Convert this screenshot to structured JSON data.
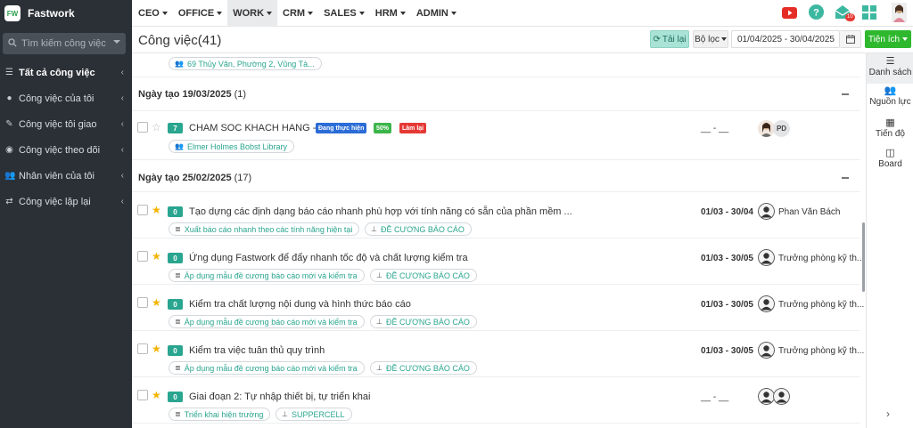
{
  "app": {
    "name": "Fastwork",
    "logo_text": "FW"
  },
  "sidebar": {
    "search_placeholder": "Tìm kiếm công việc",
    "items": [
      {
        "label": "Tất cả công việc",
        "icon": "list-icon"
      },
      {
        "label": "Công việc của tôi",
        "icon": "user-icon"
      },
      {
        "label": "Công việc tôi giao",
        "icon": "pencil-icon"
      },
      {
        "label": "Công việc theo dõi",
        "icon": "eye-icon"
      },
      {
        "label": "Nhân viên của tôi",
        "icon": "users-icon"
      },
      {
        "label": "Công việc lặp lại",
        "icon": "repeat-icon"
      }
    ]
  },
  "topmenu": [
    "CEO",
    "OFFICE",
    "WORK",
    "CRM",
    "SALES",
    "HRM",
    "ADMIN"
  ],
  "topbar": {
    "notification_count": "10"
  },
  "header": {
    "title": "Công việc(41)",
    "reload_label": "Tải lại",
    "filter_label": "Bộ lọc",
    "date_range": "01/04/2025 - 30/04/2025",
    "utilities_label": "Tiện ích"
  },
  "list": {
    "top_pill": "69 Thủy Văn, Phường 2, Vũng Tà...",
    "groups": [
      {
        "label": "Ngày tạo 19/03/2025",
        "count": "(1)",
        "tasks": [
          {
            "count": "7",
            "starred": false,
            "title": "CHAM SOC KHACH HANG - YEN",
            "badges": [
              {
                "text": "Đang thực hiện",
                "color": "#2b6cd6"
              },
              {
                "text": "50%",
                "color": "#3cb54a"
              },
              {
                "text": "Làm lại",
                "color": "#e53935"
              }
            ],
            "date": "__ - __",
            "assignee_initials": "PD",
            "pills": [
              {
                "text": "Elmer Holmes Bobst Library",
                "icon": "users-icon"
              }
            ]
          }
        ]
      },
      {
        "label": "Ngày tạo 25/02/2025",
        "count": "(17)",
        "tasks": [
          {
            "count": "0",
            "starred": true,
            "title": "Tạo dựng các định dạng báo cáo nhanh phù hợp với tính năng có sẵn của phần mềm ...",
            "date": "01/03 - 30/04",
            "assignee": "Phan Văn Bách",
            "pills": [
              {
                "text": "Xuất báo cáo nhanh theo các tính năng hiện tại",
                "icon": "list-icon"
              },
              {
                "text": "ĐỀ CƯƠNG BÁO CÁO",
                "icon": "sitemap-icon"
              }
            ]
          },
          {
            "count": "0",
            "starred": true,
            "title": "Ứng dụng Fastwork để đẩy nhanh tốc độ và chất lượng kiểm tra",
            "date": "01/03 - 30/05",
            "assignee": "Trưởng phòng kỹ th...",
            "pills": [
              {
                "text": "Áp dụng mẫu đề cương báo cáo mới và kiểm tra",
                "icon": "list-icon"
              },
              {
                "text": "ĐỀ CƯƠNG BÁO CÁO",
                "icon": "sitemap-icon"
              }
            ]
          },
          {
            "count": "0",
            "starred": true,
            "title": "Kiểm tra chất lượng nội dung và hình thức báo cáo",
            "date": "01/03 - 30/05",
            "assignee": "Trưởng phòng kỹ th...",
            "pills": [
              {
                "text": "Áp dụng mẫu đề cương báo cáo mới và kiểm tra",
                "icon": "list-icon"
              },
              {
                "text": "ĐỀ CƯƠNG BÁO CÁO",
                "icon": "sitemap-icon"
              }
            ]
          },
          {
            "count": "0",
            "starred": true,
            "title": "Kiểm tra việc tuân thủ quy trình",
            "date": "01/03 - 30/05",
            "assignee": "Trưởng phòng kỹ th...",
            "pills": [
              {
                "text": "Áp dụng mẫu đề cương báo cáo mới và kiểm tra",
                "icon": "list-icon"
              },
              {
                "text": "ĐỀ CƯƠNG BÁO CÁO",
                "icon": "sitemap-icon"
              }
            ]
          },
          {
            "count": "0",
            "starred": true,
            "title": "Giai đoạn 2: Tự nhập thiết bị, tự triển khai",
            "date": "__ - __",
            "assignee": "",
            "pills": [
              {
                "text": "Triển khai hiện trường",
                "icon": "list-icon"
              },
              {
                "text": "SUPPERCELL",
                "icon": "sitemap-icon"
              }
            ]
          }
        ]
      }
    ]
  },
  "views": [
    {
      "label": "Danh sách",
      "icon": "list-view-icon"
    },
    {
      "label": "Nguồn lực",
      "icon": "users-icon"
    },
    {
      "label": "Tiến độ",
      "icon": "table-icon"
    },
    {
      "label": "Board",
      "icon": "columns-icon"
    }
  ],
  "colors": {
    "sidebar_bg": "#2b3036",
    "accent_green": "#2aa58f",
    "utilities_btn": "#2eb82e",
    "reload_btn": "#a9e3d6"
  }
}
